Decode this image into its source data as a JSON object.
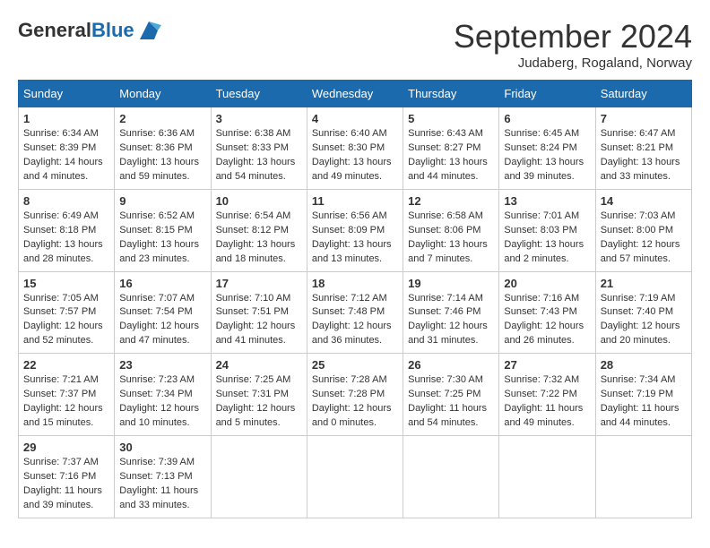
{
  "header": {
    "logo_general": "General",
    "logo_blue": "Blue",
    "month_title": "September 2024",
    "subtitle": "Judaberg, Rogaland, Norway"
  },
  "weekdays": [
    "Sunday",
    "Monday",
    "Tuesday",
    "Wednesday",
    "Thursday",
    "Friday",
    "Saturday"
  ],
  "weeks": [
    [
      {
        "day": "1",
        "info": "Sunrise: 6:34 AM\nSunset: 8:39 PM\nDaylight: 14 hours\nand 4 minutes."
      },
      {
        "day": "2",
        "info": "Sunrise: 6:36 AM\nSunset: 8:36 PM\nDaylight: 13 hours\nand 59 minutes."
      },
      {
        "day": "3",
        "info": "Sunrise: 6:38 AM\nSunset: 8:33 PM\nDaylight: 13 hours\nand 54 minutes."
      },
      {
        "day": "4",
        "info": "Sunrise: 6:40 AM\nSunset: 8:30 PM\nDaylight: 13 hours\nand 49 minutes."
      },
      {
        "day": "5",
        "info": "Sunrise: 6:43 AM\nSunset: 8:27 PM\nDaylight: 13 hours\nand 44 minutes."
      },
      {
        "day": "6",
        "info": "Sunrise: 6:45 AM\nSunset: 8:24 PM\nDaylight: 13 hours\nand 39 minutes."
      },
      {
        "day": "7",
        "info": "Sunrise: 6:47 AM\nSunset: 8:21 PM\nDaylight: 13 hours\nand 33 minutes."
      }
    ],
    [
      {
        "day": "8",
        "info": "Sunrise: 6:49 AM\nSunset: 8:18 PM\nDaylight: 13 hours\nand 28 minutes."
      },
      {
        "day": "9",
        "info": "Sunrise: 6:52 AM\nSunset: 8:15 PM\nDaylight: 13 hours\nand 23 minutes."
      },
      {
        "day": "10",
        "info": "Sunrise: 6:54 AM\nSunset: 8:12 PM\nDaylight: 13 hours\nand 18 minutes."
      },
      {
        "day": "11",
        "info": "Sunrise: 6:56 AM\nSunset: 8:09 PM\nDaylight: 13 hours\nand 13 minutes."
      },
      {
        "day": "12",
        "info": "Sunrise: 6:58 AM\nSunset: 8:06 PM\nDaylight: 13 hours\nand 7 minutes."
      },
      {
        "day": "13",
        "info": "Sunrise: 7:01 AM\nSunset: 8:03 PM\nDaylight: 13 hours\nand 2 minutes."
      },
      {
        "day": "14",
        "info": "Sunrise: 7:03 AM\nSunset: 8:00 PM\nDaylight: 12 hours\nand 57 minutes."
      }
    ],
    [
      {
        "day": "15",
        "info": "Sunrise: 7:05 AM\nSunset: 7:57 PM\nDaylight: 12 hours\nand 52 minutes."
      },
      {
        "day": "16",
        "info": "Sunrise: 7:07 AM\nSunset: 7:54 PM\nDaylight: 12 hours\nand 47 minutes."
      },
      {
        "day": "17",
        "info": "Sunrise: 7:10 AM\nSunset: 7:51 PM\nDaylight: 12 hours\nand 41 minutes."
      },
      {
        "day": "18",
        "info": "Sunrise: 7:12 AM\nSunset: 7:48 PM\nDaylight: 12 hours\nand 36 minutes."
      },
      {
        "day": "19",
        "info": "Sunrise: 7:14 AM\nSunset: 7:46 PM\nDaylight: 12 hours\nand 31 minutes."
      },
      {
        "day": "20",
        "info": "Sunrise: 7:16 AM\nSunset: 7:43 PM\nDaylight: 12 hours\nand 26 minutes."
      },
      {
        "day": "21",
        "info": "Sunrise: 7:19 AM\nSunset: 7:40 PM\nDaylight: 12 hours\nand 20 minutes."
      }
    ],
    [
      {
        "day": "22",
        "info": "Sunrise: 7:21 AM\nSunset: 7:37 PM\nDaylight: 12 hours\nand 15 minutes."
      },
      {
        "day": "23",
        "info": "Sunrise: 7:23 AM\nSunset: 7:34 PM\nDaylight: 12 hours\nand 10 minutes."
      },
      {
        "day": "24",
        "info": "Sunrise: 7:25 AM\nSunset: 7:31 PM\nDaylight: 12 hours\nand 5 minutes."
      },
      {
        "day": "25",
        "info": "Sunrise: 7:28 AM\nSunset: 7:28 PM\nDaylight: 12 hours\nand 0 minutes."
      },
      {
        "day": "26",
        "info": "Sunrise: 7:30 AM\nSunset: 7:25 PM\nDaylight: 11 hours\nand 54 minutes."
      },
      {
        "day": "27",
        "info": "Sunrise: 7:32 AM\nSunset: 7:22 PM\nDaylight: 11 hours\nand 49 minutes."
      },
      {
        "day": "28",
        "info": "Sunrise: 7:34 AM\nSunset: 7:19 PM\nDaylight: 11 hours\nand 44 minutes."
      }
    ],
    [
      {
        "day": "29",
        "info": "Sunrise: 7:37 AM\nSunset: 7:16 PM\nDaylight: 11 hours\nand 39 minutes."
      },
      {
        "day": "30",
        "info": "Sunrise: 7:39 AM\nSunset: 7:13 PM\nDaylight: 11 hours\nand 33 minutes."
      },
      {
        "day": "",
        "info": ""
      },
      {
        "day": "",
        "info": ""
      },
      {
        "day": "",
        "info": ""
      },
      {
        "day": "",
        "info": ""
      },
      {
        "day": "",
        "info": ""
      }
    ]
  ]
}
